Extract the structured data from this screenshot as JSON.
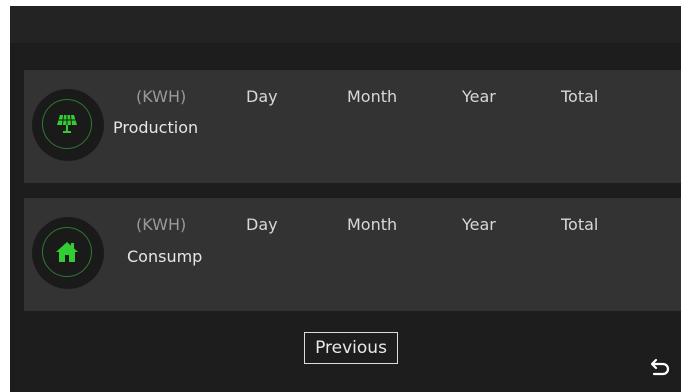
{
  "columns": {
    "unit": "(KWH)",
    "day": "Day",
    "month": "Month",
    "year": "Year",
    "total": "Total"
  },
  "rows": [
    {
      "name": "Production",
      "icon": "solar-panel-icon"
    },
    {
      "name": "Consump",
      "icon": "home-icon"
    }
  ],
  "buttons": {
    "previous": "Previous",
    "back_icon": "return-arrow-icon"
  },
  "colors": {
    "accent": "#33cc33",
    "background": "#1d1d1d",
    "card": "#333333"
  }
}
